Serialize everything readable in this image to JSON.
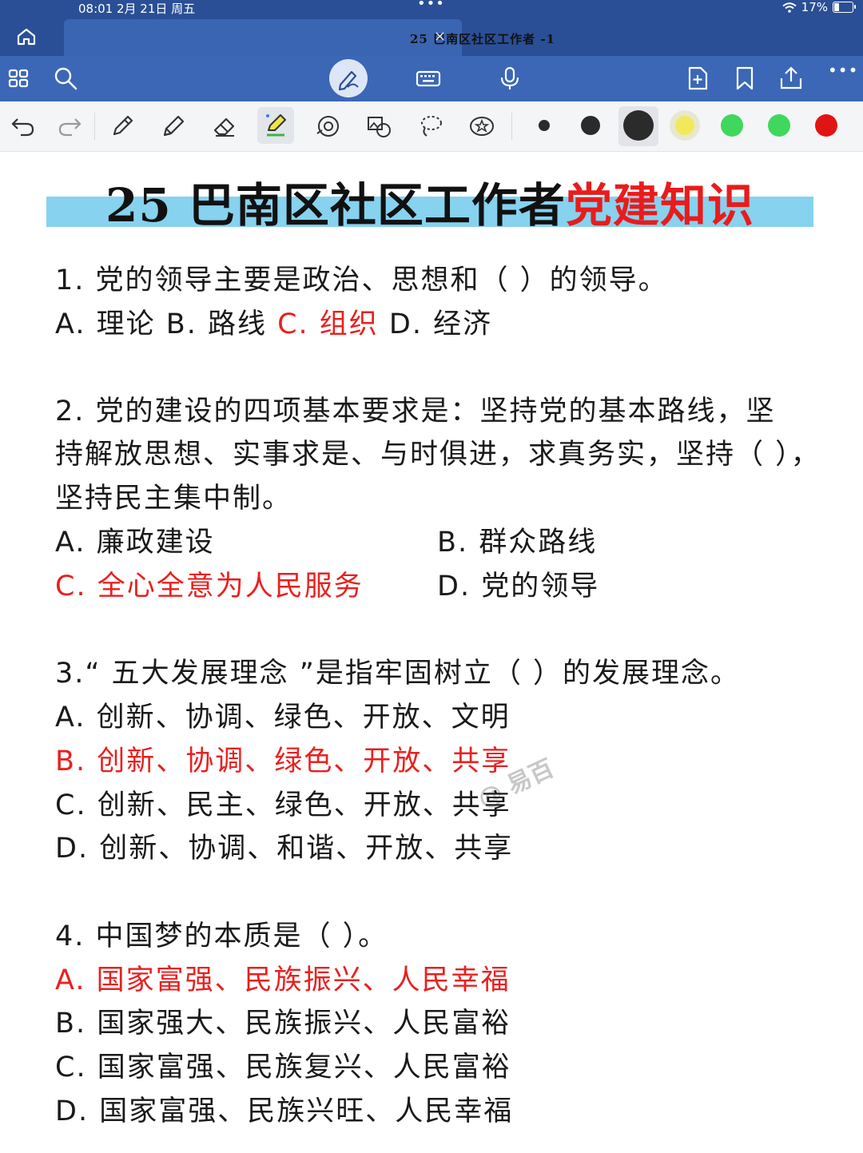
{
  "status_bar": {
    "time": "08:01  2月 21日  周五",
    "dots": "•••",
    "battery_percent": "17%"
  },
  "tab": {
    "title": "25 巴南区社区工作者 -1",
    "close": "×"
  },
  "toolbar": {
    "icons": [
      "apps-grid-icon",
      "search-icon",
      "pen-mode-icon",
      "keyboard-icon",
      "microphone-icon",
      "add-page-icon",
      "bookmark-icon",
      "share-icon",
      "more-icon"
    ],
    "more": "•••"
  },
  "drawbar": {
    "tools": [
      "undo-icon",
      "redo-icon",
      "pen-icon",
      "pencil-icon",
      "eraser-icon",
      "highlighter-icon",
      "shape-icon",
      "image-tool-icon",
      "lasso-icon",
      "sticker-icon"
    ],
    "colors": [
      "#2b2b2b",
      "#2b2b2b",
      "#2b2b2b",
      "#f3e85c",
      "#3fd85c",
      "#3fd85c",
      "#e11414"
    ]
  },
  "document": {
    "title_black": "25 巴南区社区工作者",
    "title_red": "党建知识",
    "watermark": "@ 易百",
    "questions": [
      {
        "lines": [
          "1. 党的领导主要是政治、思想和（ ）的领导。"
        ],
        "options_inline": {
          "a": "A. 理论  B. 路线 ",
          "c": "C. 组织",
          "d": " D. 经济"
        }
      },
      {
        "lines": [
          "2. 党的建设的四项基本要求是：坚持党的基本路线，坚",
          "持解放思想、实事求是、与时俱进，求真务实，坚持（ ），",
          "坚持民主集中制。"
        ],
        "options": [
          "A. 廉政建设",
          "B. 群众路线",
          "C. 全心全意为人民服务",
          "D. 党的领导"
        ],
        "answer_index": 2
      },
      {
        "lines": [
          "3.“ 五大发展理念 ”是指牢固树立（ ）的发展理念。"
        ],
        "options": [
          "A. 创新、协调、绿色、开放、文明",
          "B. 创新、协调、绿色、开放、共享",
          "C. 创新、民主、绿色、开放、共享",
          "D. 创新、协调、和谐、开放、共享"
        ],
        "answer_index": 1
      },
      {
        "lines": [
          "4. 中国梦的本质是（ ）。"
        ],
        "options": [
          "A. 国家富强、民族振兴、人民幸福",
          "B. 国家强大、民族振兴、人民富裕",
          "C. 国家富强、民族复兴、人民富裕",
          "D. 国家富强、民族兴旺、人民幸福"
        ],
        "answer_index": 0
      }
    ]
  }
}
